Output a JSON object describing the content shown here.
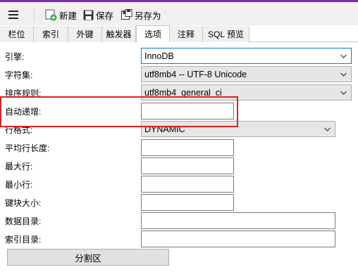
{
  "toolbar": {
    "new_label": "新建",
    "save_label": "保存",
    "save_as_label": "另存为"
  },
  "tabs": [
    "栏位",
    "索引",
    "外键",
    "触发器",
    "选项",
    "注释",
    "SQL 预览"
  ],
  "active_tab": "选项",
  "form": {
    "engine_label": "引擎:",
    "engine_value": "InnoDB",
    "charset_label": "字符集:",
    "charset_value": "utf8mb4 -- UTF-8 Unicode",
    "collation_label": "排序规则:",
    "collation_value": "utf8mb4_general_ci",
    "auto_increment_label": "自动递增:",
    "auto_increment_value": "",
    "row_format_label": "行格式:",
    "row_format_value": "DYNAMIC",
    "avg_row_length_label": "平均行长度:",
    "avg_row_length_value": "",
    "max_rows_label": "最大行:",
    "max_rows_value": "",
    "min_rows_label": "最小行:",
    "min_rows_value": "",
    "key_block_size_label": "键块大小:",
    "key_block_size_value": "",
    "data_directory_label": "数据目录:",
    "data_directory_value": "",
    "index_directory_label": "索引目录:",
    "index_directory_value": "",
    "partition_button_label": "分割区"
  },
  "colors": {
    "accent": "#7b2fb0",
    "highlight_box": "#e02020",
    "focus_border": "#0a78d7",
    "new_icon_green": "#2ea043"
  },
  "icons": [
    "menu-icon",
    "new-icon",
    "save-icon",
    "save-as-icon",
    "chevron-down-icon"
  ]
}
